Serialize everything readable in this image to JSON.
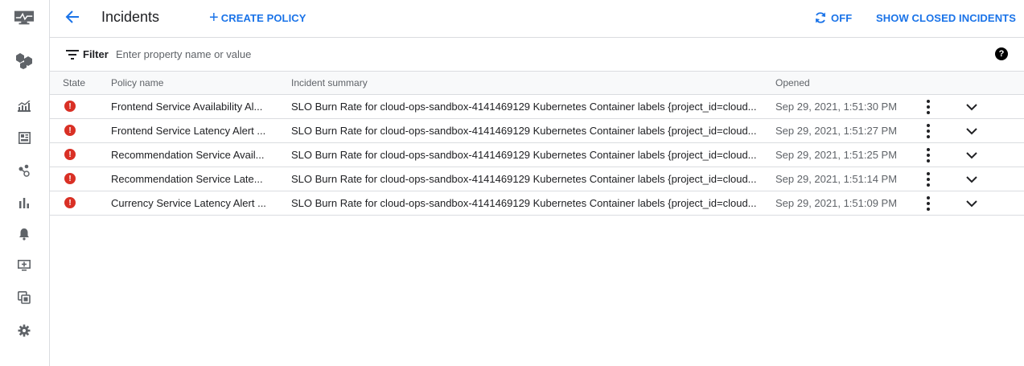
{
  "header": {
    "title": "Incidents",
    "create_policy_label": "CREATE POLICY",
    "refresh_label": "OFF",
    "show_closed_label": "SHOW CLOSED INCIDENTS"
  },
  "filter": {
    "label": "Filter",
    "placeholder": "Enter property name or value"
  },
  "table": {
    "columns": [
      "State",
      "Policy name",
      "Incident summary",
      "Opened"
    ],
    "rows": [
      {
        "policy": "Frontend Service Availability Al...",
        "summary": "SLO Burn Rate for cloud-ops-sandbox-4141469129 Kubernetes Container labels {project_id=cloud...",
        "opened": "Sep 29, 2021, 1:51:30 PM"
      },
      {
        "policy": "Frontend Service Latency Alert ...",
        "summary": "SLO Burn Rate for cloud-ops-sandbox-4141469129 Kubernetes Container labels {project_id=cloud...",
        "opened": "Sep 29, 2021, 1:51:27 PM"
      },
      {
        "policy": "Recommendation Service Avail...",
        "summary": "SLO Burn Rate for cloud-ops-sandbox-4141469129 Kubernetes Container labels {project_id=cloud...",
        "opened": "Sep 29, 2021, 1:51:25 PM"
      },
      {
        "policy": "Recommendation Service Late...",
        "summary": "SLO Burn Rate for cloud-ops-sandbox-4141469129 Kubernetes Container labels {project_id=cloud...",
        "opened": "Sep 29, 2021, 1:51:14 PM"
      },
      {
        "policy": "Currency Service Latency Alert ...",
        "summary": "SLO Burn Rate for cloud-ops-sandbox-4141469129 Kubernetes Container labels {project_id=cloud...",
        "opened": "Sep 29, 2021, 1:51:09 PM"
      }
    ]
  },
  "sidebar": {
    "icons": [
      "monitoring-logo-icon",
      "services-icon",
      "metrics-explorer-icon",
      "dashboards-icon",
      "uptime-icon",
      "charts-icon",
      "alerting-bell-icon",
      "monitors-icon",
      "groups-icon",
      "settings-gear-icon"
    ]
  },
  "colors": {
    "accent": "#1a73e8",
    "error": "#d93025",
    "border": "#dadce0",
    "header_bg": "#f8f9fa"
  }
}
